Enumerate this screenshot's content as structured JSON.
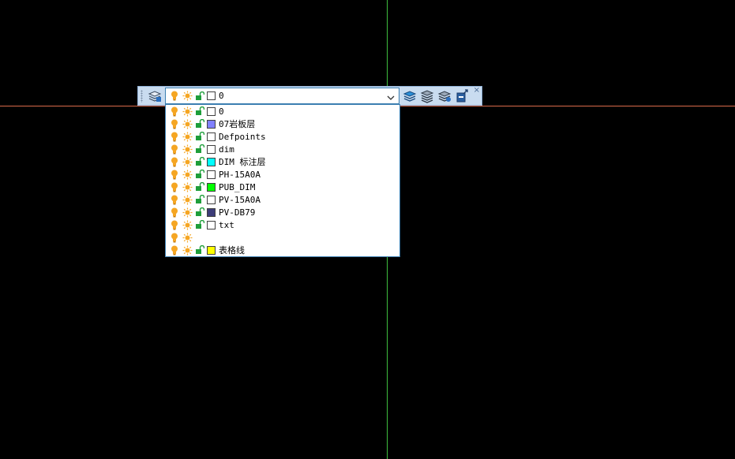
{
  "layer_toolbar": {
    "current_layer": {
      "name": "0",
      "color": "#ffffff",
      "on": true,
      "frozen": false,
      "locked": false
    },
    "tools": [
      {
        "icon": "layer-properties-icon"
      },
      {
        "icon": "make-current-layer-icon"
      },
      {
        "icon": "layer-previous-icon"
      },
      {
        "icon": "layer-isolate-icon"
      },
      {
        "icon": "layer-match-icon"
      }
    ],
    "close_glyph": "×"
  },
  "layers": [
    {
      "name": "0",
      "color": "#ffffff",
      "show_lock": true,
      "show_swatch": true
    },
    {
      "name": "07岩板层",
      "color": "#8080ff",
      "show_lock": true,
      "show_swatch": true
    },
    {
      "name": "Defpoints",
      "color": "#ffffff",
      "show_lock": true,
      "show_swatch": true
    },
    {
      "name": "dim",
      "color": "#ffffff",
      "show_lock": true,
      "show_swatch": true
    },
    {
      "name": "DIM 标注层",
      "color": "#00ffff",
      "show_lock": true,
      "show_swatch": true
    },
    {
      "name": "PH-15A0A",
      "color": "#ffffff",
      "show_lock": true,
      "show_swatch": true
    },
    {
      "name": "PUB_DIM",
      "color": "#00ff00",
      "show_lock": true,
      "show_swatch": true
    },
    {
      "name": "PV-15A0A",
      "color": "#ffffff",
      "show_lock": true,
      "show_swatch": true
    },
    {
      "name": "PV-DB79",
      "color": "#3c3c78",
      "show_lock": true,
      "show_swatch": true
    },
    {
      "name": "txt",
      "color": "#ffffff",
      "show_lock": true,
      "show_swatch": true
    },
    {
      "name": "",
      "color": "",
      "show_lock": false,
      "show_swatch": false
    },
    {
      "name": "表格线",
      "color": "#ffff00",
      "show_lock": true,
      "show_swatch": true
    }
  ],
  "colors": {
    "bulb": "#f5a623",
    "sun": "#f5a623",
    "lock": "#1e9e3a",
    "crosshair_vertical": "#3fbf3f",
    "crosshair_horizontal": "#d96a4a"
  }
}
